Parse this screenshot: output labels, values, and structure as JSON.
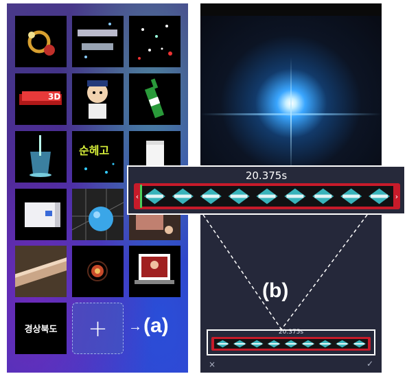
{
  "left": {
    "tiles": [
      {
        "name": "tile-fire-ring",
        "kind": "ring"
      },
      {
        "name": "tile-glow-text",
        "kind": "glowtext"
      },
      {
        "name": "tile-particles",
        "kind": "particles"
      },
      {
        "name": "tile-3d-text",
        "kind": "text3d"
      },
      {
        "name": "tile-cartoon",
        "kind": "cartoon"
      },
      {
        "name": "tile-bottle",
        "kind": "bottle"
      },
      {
        "name": "tile-glass",
        "kind": "glass"
      },
      {
        "name": "tile-neon-text",
        "kind": "neon"
      },
      {
        "name": "tile-white-block",
        "kind": "white"
      },
      {
        "name": "tile-device",
        "kind": "device"
      },
      {
        "name": "tile-sphere",
        "kind": "sphere"
      },
      {
        "name": "tile-photo",
        "kind": "photo"
      },
      {
        "name": "tile-pipe",
        "kind": "pipe"
      },
      {
        "name": "tile-orb",
        "kind": "orb"
      },
      {
        "name": "tile-frame-photo",
        "kind": "frame"
      }
    ],
    "text_tile_label": "경상북도",
    "add_label": "+",
    "annotation": "(a)"
  },
  "right": {
    "annotation": "(b)",
    "small_time": "20.375s",
    "close_icon": "×",
    "confirm_icon": "✓"
  },
  "zoom": {
    "time": "20.375s",
    "left_handle": "‹",
    "right_handle": "›"
  },
  "colors": {
    "track_red": "#c71b2a",
    "teal": "#3fd0d8",
    "green": "#49d05a"
  }
}
